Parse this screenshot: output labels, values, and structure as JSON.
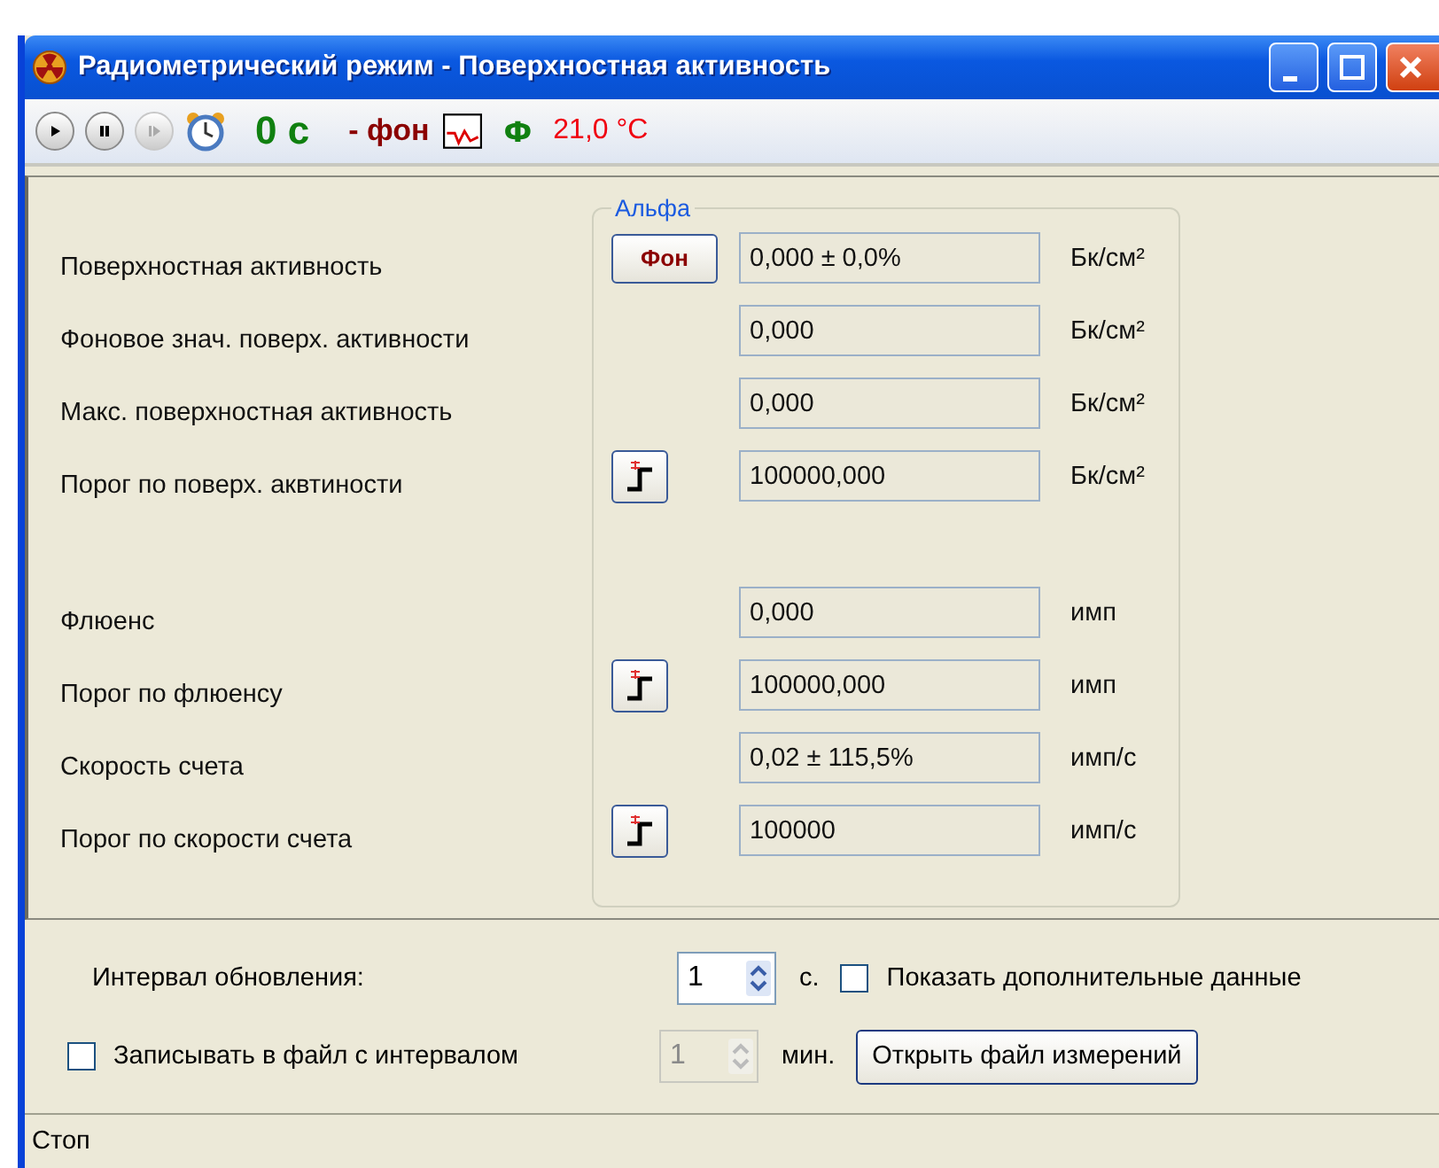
{
  "window": {
    "title": "Радиометрический режим - Поверхностная активность"
  },
  "toolbar": {
    "buttons": [
      {
        "kind": "play",
        "disabled": false
      },
      {
        "kind": "pause",
        "disabled": false
      },
      {
        "kind": "step",
        "disabled": true
      }
    ],
    "timer": "0 с",
    "background": "- фон",
    "flux": "Ф",
    "temperature": "21,0 °C"
  },
  "group": {
    "title": "Альфа"
  },
  "sections": [
    {
      "rows": [
        {
          "label": "Поверхностная активность",
          "kind": "background",
          "button_label": "Фон",
          "value": "0,000 ± 0,0%",
          "unit": "Бк/см²"
        },
        {
          "label": "Фоновое знач. поверх. активности",
          "kind": "plain",
          "value": "0,000",
          "unit": "Бк/см²"
        },
        {
          "label": "Макс. поверхностная активность",
          "kind": "plain",
          "value": "0,000",
          "unit": "Бк/см²"
        },
        {
          "label": "Порог по поверх. аквтиности",
          "kind": "threshold",
          "value": "100000,000",
          "unit": "Бк/см²"
        }
      ]
    },
    {
      "rows": [
        {
          "label": "Флюенс",
          "kind": "plain",
          "value": "0,000",
          "unit": "имп"
        },
        {
          "label": "Порог по флюенсу",
          "kind": "threshold",
          "value": "100000,000",
          "unit": "имп"
        },
        {
          "label": "Скорость счета",
          "kind": "plain",
          "value": "0,02 ± 115,5%",
          "unit": "имп/с"
        },
        {
          "label": "Порог по скорости счета",
          "kind": "threshold",
          "value": "100000",
          "unit": "имп/с"
        }
      ]
    }
  ],
  "interval": {
    "label": "Интервал обновления:",
    "value": "1",
    "unit": "с.",
    "disabled": false
  },
  "show_extra": {
    "label": "Показать дополнительные данные",
    "checked": false
  },
  "record": {
    "label": "Записывать в файл с интервалом",
    "checked": false,
    "value": "1",
    "unit": "мин.",
    "disabled": true
  },
  "open_button": "Открыть файл измерений",
  "status_bar": "Стоп"
}
